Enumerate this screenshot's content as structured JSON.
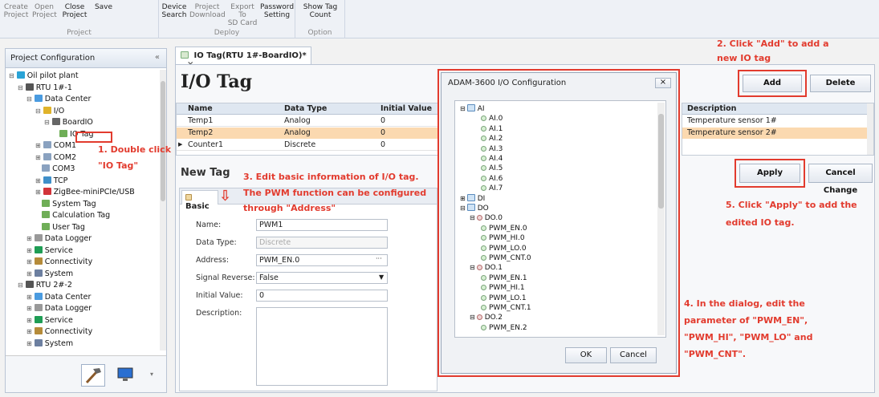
{
  "ribbon": {
    "groups": [
      {
        "label": "Project",
        "buttons": [
          [
            "Create",
            "Project"
          ],
          [
            "Open",
            "Project"
          ],
          [
            "Close",
            "Project"
          ],
          [
            "Save",
            ""
          ]
        ]
      },
      {
        "label": "Deploy",
        "buttons": [
          [
            "Device",
            "Search"
          ],
          [
            "Project",
            "Download"
          ],
          [
            "Export To",
            "SD Card"
          ],
          [
            "Password",
            "Setting"
          ]
        ]
      },
      {
        "label": "Option",
        "buttons": [
          [
            "Show Tag",
            "Count"
          ]
        ]
      }
    ]
  },
  "sidebar": {
    "title": "Project Configuration",
    "collapse": "«",
    "tree": [
      {
        "label": "Oil pilot plant",
        "x": "⊟",
        "icon": "project-icon"
      },
      {
        "label": "RTU 1#-1",
        "x": "⊟",
        "icon": "rtu-icon"
      },
      {
        "label": "Data Center",
        "x": "⊟",
        "icon": "datacenter-icon"
      },
      {
        "label": "I/O",
        "x": "⊟",
        "icon": "io-icon"
      },
      {
        "label": "BoardIO",
        "x": "⊟",
        "icon": "board-icon"
      },
      {
        "label": "IO Tag",
        "x": "",
        "icon": "tag-icon"
      },
      {
        "label": "COM1",
        "x": "⊞",
        "icon": "com-icon"
      },
      {
        "label": "COM2",
        "x": "⊞",
        "icon": "com-icon"
      },
      {
        "label": "COM3",
        "x": "",
        "icon": "com-icon"
      },
      {
        "label": "TCP",
        "x": "⊞",
        "icon": "tcp-icon"
      },
      {
        "label": "ZigBee-miniPCIe/USB",
        "x": "⊞",
        "icon": "zigbee-icon"
      },
      {
        "label": "System Tag",
        "x": "",
        "icon": "tag-icon"
      },
      {
        "label": "Calculation Tag",
        "x": "",
        "icon": "tag-icon"
      },
      {
        "label": "User Tag",
        "x": "",
        "icon": "tag-icon"
      },
      {
        "label": "Data Logger",
        "x": "⊞",
        "icon": "logger-icon"
      },
      {
        "label": "Service",
        "x": "⊞",
        "icon": "service-icon"
      },
      {
        "label": "Connectivity",
        "x": "⊞",
        "icon": "connectivity-icon"
      },
      {
        "label": "System",
        "x": "⊞",
        "icon": "system-icon"
      },
      {
        "label": "RTU 2#-2",
        "x": "⊟",
        "icon": "rtu-icon"
      },
      {
        "label": "Data Center",
        "x": "⊞",
        "icon": "datacenter-icon"
      },
      {
        "label": "Data Logger",
        "x": "⊞",
        "icon": "logger-icon"
      },
      {
        "label": "Service",
        "x": "⊞",
        "icon": "service-icon"
      },
      {
        "label": "Connectivity",
        "x": "⊞",
        "icon": "connectivity-icon"
      },
      {
        "label": "System",
        "x": "⊞",
        "icon": "system-icon"
      }
    ],
    "bottom_icons": [
      "hammer-icon",
      "monitor-icon"
    ]
  },
  "tab": {
    "label": "IO Tag(RTU 1#-BoardIO)*",
    "close": "×"
  },
  "main": {
    "title": "I/O Tag",
    "columns": [
      "Name",
      "Data Type",
      "Initial Value",
      "Description"
    ],
    "rows": [
      {
        "name": "Temp1",
        "type": "Analog",
        "init": "0",
        "desc": "Temperature sensor 1#"
      },
      {
        "name": "Temp2",
        "type": "Analog",
        "init": "0",
        "desc": "Temperature sensor 2#"
      },
      {
        "name": "Counter1",
        "type": "Discrete",
        "init": "0",
        "desc": ""
      }
    ],
    "add": "Add",
    "delete": "Delete",
    "apply": "Apply",
    "cancel_change": "Cancel Change",
    "new_tag_title": "New Tag",
    "basic_tab": "Basic",
    "form": {
      "name_label": "Name:",
      "name": "PWM1",
      "type_label": "Data Type:",
      "type": "Discrete",
      "address_label": "Address:",
      "address": "PWM_EN.0",
      "address_btn": "···",
      "reverse_label": "Signal Reverse:",
      "reverse": "False",
      "init_label": "Initial Value:",
      "init": "0",
      "desc_label": "Description:"
    }
  },
  "dialog": {
    "title": "ADAM-3600 I/O Configuration",
    "close": "×",
    "ok": "OK",
    "cancel": "Cancel",
    "items": [
      {
        "t": "AI",
        "l": 0,
        "x": "⊟",
        "k": "folder"
      },
      {
        "t": "AI.0",
        "l": 2,
        "k": "dot"
      },
      {
        "t": "AI.1",
        "l": 2,
        "k": "dot"
      },
      {
        "t": "AI.2",
        "l": 2,
        "k": "dot"
      },
      {
        "t": "AI.3",
        "l": 2,
        "k": "dot"
      },
      {
        "t": "AI.4",
        "l": 2,
        "k": "dot"
      },
      {
        "t": "AI.5",
        "l": 2,
        "k": "dot"
      },
      {
        "t": "AI.6",
        "l": 2,
        "k": "dot"
      },
      {
        "t": "AI.7",
        "l": 2,
        "k": "dot"
      },
      {
        "t": "DI",
        "l": 0,
        "x": "⊞",
        "k": "folder"
      },
      {
        "t": "DO",
        "l": 0,
        "x": "⊟",
        "k": "folder"
      },
      {
        "t": "DO.0",
        "l": 1,
        "x": "⊟",
        "k": "dotr"
      },
      {
        "t": "PWM_EN.0",
        "l": 2,
        "k": "dot"
      },
      {
        "t": "PWM_HI.0",
        "l": 2,
        "k": "dot"
      },
      {
        "t": "PWM_LO.0",
        "l": 2,
        "k": "dot"
      },
      {
        "t": "PWM_CNT.0",
        "l": 2,
        "k": "dot"
      },
      {
        "t": "DO.1",
        "l": 1,
        "x": "⊟",
        "k": "dotr"
      },
      {
        "t": "PWM_EN.1",
        "l": 2,
        "k": "dot"
      },
      {
        "t": "PWM_HI.1",
        "l": 2,
        "k": "dot"
      },
      {
        "t": "PWM_LO.1",
        "l": 2,
        "k": "dot"
      },
      {
        "t": "PWM_CNT.1",
        "l": 2,
        "k": "dot"
      },
      {
        "t": "DO.2",
        "l": 1,
        "x": "⊟",
        "k": "dotr"
      },
      {
        "t": "PWM_EN.2",
        "l": 2,
        "k": "dot"
      }
    ]
  },
  "annotations": {
    "a1": "1. Double click",
    "a1b": "\"IO Tag\"",
    "a2": "2. Click \"Add\" to add a",
    "a2b": "new IO tag",
    "a3": "3. Edit basic information of I/O tag.",
    "a3b": "The PWM function can be configured",
    "a3c": "through \"Address\"",
    "a4": "4. In the dialog, edit the",
    "a4b": "parameter of \"PWM_EN\",",
    "a4c": "\"PWM_HI\", \"PWM_LO\" and",
    "a4d": "\"PWM_CNT\".",
    "a5": "5. Click \"Apply\" to add the",
    "a5b": "edited IO tag.",
    "arrow": "⇩"
  },
  "colors": {
    "accent": "#e23b2e",
    "selected_row": "#fbd9b0",
    "header": "#dfe7f1"
  }
}
